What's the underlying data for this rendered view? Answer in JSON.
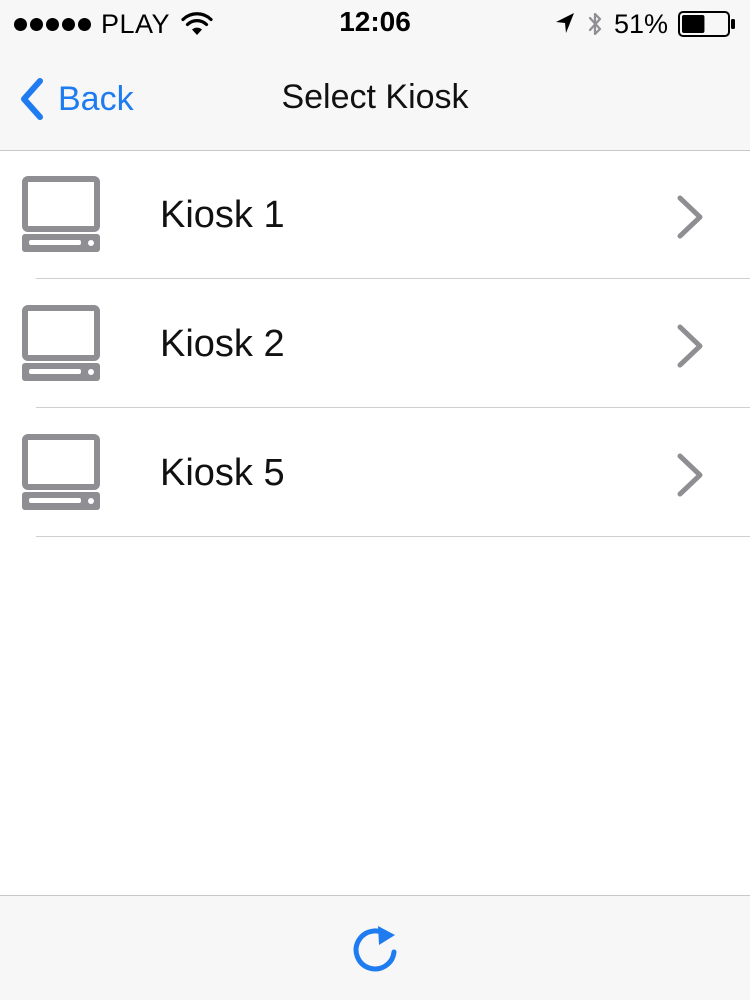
{
  "status_bar": {
    "carrier": "PLAY",
    "time": "12:06",
    "battery": "51%",
    "battery_level": 0.51,
    "signal_bars": 5
  },
  "nav": {
    "back_label": "Back",
    "title": "Select Kiosk"
  },
  "kiosks": [
    {
      "label": "Kiosk 1",
      "icon": "computer-icon"
    },
    {
      "label": "Kiosk 2",
      "icon": "computer-icon"
    },
    {
      "label": "Kiosk 5",
      "icon": "computer-icon"
    }
  ],
  "toolbar": {
    "refresh_icon": "refresh-icon"
  },
  "colors": {
    "accent": "#1f7bf0",
    "icon_gray": "#8e8e93",
    "bar_background": "#f7f7f7",
    "separator": "#cfcfd3"
  }
}
